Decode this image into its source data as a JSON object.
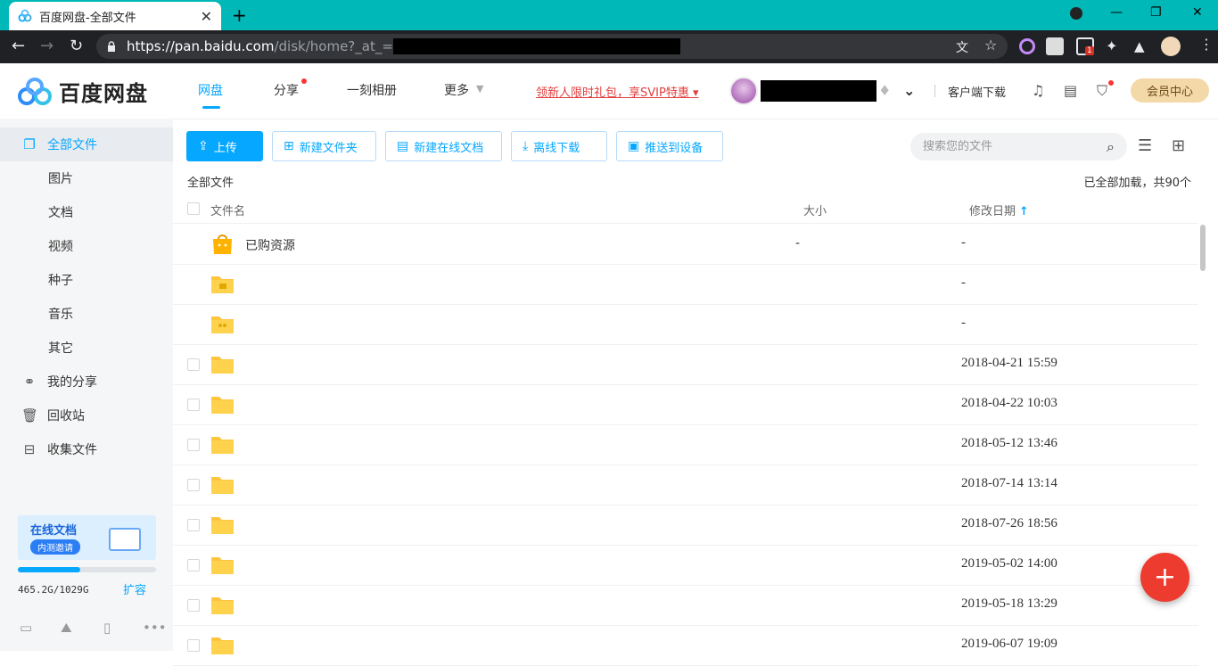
{
  "browser": {
    "tab_title": "百度网盘-全部文件",
    "tab_close": "✕",
    "new_tab": "+",
    "url_host": "https://pan.baidu.com",
    "url_path": "/disk/home?_at_=",
    "ext_badge": "1"
  },
  "header": {
    "logo_text": "百度网盘",
    "nav": [
      {
        "label": "网盘"
      },
      {
        "label": "分享"
      },
      {
        "label": "一刻相册"
      },
      {
        "label": "更多"
      }
    ],
    "promo": "领新人限时礼包，享SVIP特惠 ▾",
    "client_download": "客户端下载",
    "vip_center": "会员中心"
  },
  "sidebar": {
    "items": [
      {
        "label": "全部文件"
      },
      {
        "label": "图片"
      },
      {
        "label": "文档"
      },
      {
        "label": "视频"
      },
      {
        "label": "种子"
      },
      {
        "label": "音乐"
      },
      {
        "label": "其它"
      },
      {
        "label": "我的分享"
      },
      {
        "label": "回收站"
      },
      {
        "label": "收集文件"
      }
    ],
    "banner_title": "在线文档",
    "banner_sub": "内测邀请",
    "quota_text": "465.2G/1029G",
    "quota_fraction": 0.452,
    "expand": "扩容"
  },
  "toolbar": {
    "upload": "上传",
    "new_folder": "新建文件夹",
    "new_doc": "新建在线文档",
    "offline": "离线下载",
    "push": "推送到设备",
    "search_placeholder": "搜索您的文件"
  },
  "list": {
    "breadcrumb": "全部文件",
    "loaded": "已全部加载，共90个",
    "col_name": "文件名",
    "col_size": "大小",
    "col_date": "修改日期",
    "sort_arrow": "↑",
    "rows": [
      {
        "name": "已购资源",
        "size": "-",
        "date": "-"
      },
      {
        "name": "",
        "size": "",
        "date": "-"
      },
      {
        "name": "",
        "size": "",
        "date": "-"
      },
      {
        "name": "",
        "size": "",
        "date": "2018-04-21 15:59"
      },
      {
        "name": "",
        "size": "",
        "date": "2018-04-22 10:03"
      },
      {
        "name": "",
        "size": "",
        "date": "2018-05-12 13:46"
      },
      {
        "name": "",
        "size": "",
        "date": "2018-07-14 13:14"
      },
      {
        "name": "",
        "size": "",
        "date": "2018-07-26 18:56"
      },
      {
        "name": "",
        "size": "",
        "date": "2019-05-02 14:00"
      },
      {
        "name": "",
        "size": "",
        "date": "2019-05-18 13:29"
      },
      {
        "name": "",
        "size": "",
        "date": "2019-06-07 19:09"
      }
    ]
  },
  "colors": {
    "accent": "#06a7ff",
    "fab": "#ee3b2f",
    "folder": "#ffc53d"
  }
}
